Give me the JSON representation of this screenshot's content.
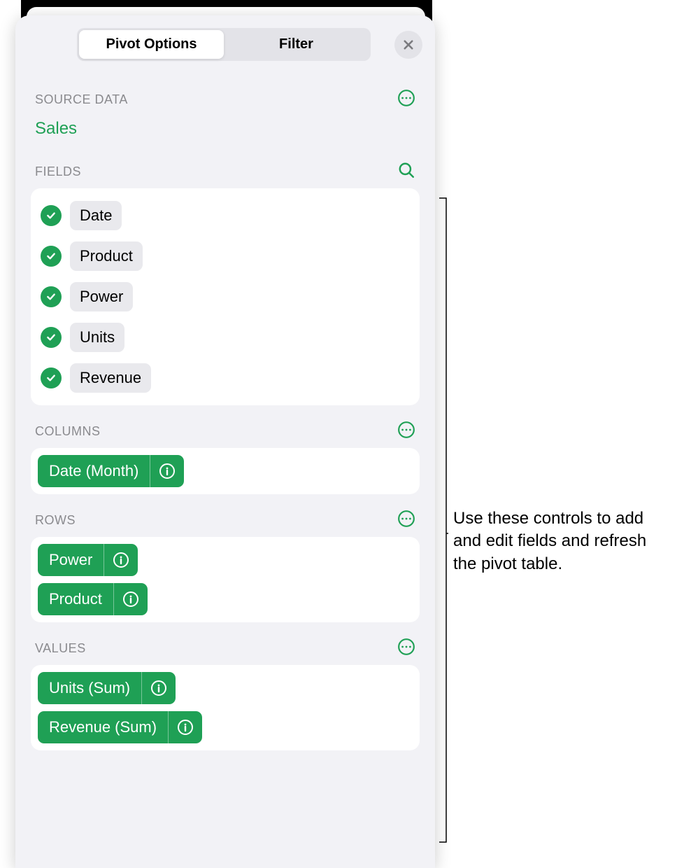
{
  "tabs": {
    "pivot_options": "Pivot Options",
    "filter": "Filter"
  },
  "sections": {
    "source_data": "SOURCE DATA",
    "fields": "FIELDS",
    "columns": "COLUMNS",
    "rows": "ROWS",
    "values": "VALUES"
  },
  "source_name": "Sales",
  "fields": [
    {
      "label": "Date"
    },
    {
      "label": "Product"
    },
    {
      "label": "Power"
    },
    {
      "label": "Units"
    },
    {
      "label": "Revenue"
    }
  ],
  "columns": [
    {
      "label": "Date (Month)"
    }
  ],
  "rows": [
    {
      "label": "Power"
    },
    {
      "label": "Product"
    }
  ],
  "values": [
    {
      "label": "Units  (Sum)"
    },
    {
      "label": "Revenue  (Sum)"
    }
  ],
  "callout": "Use these controls to add and edit fields and refresh the pivot table."
}
